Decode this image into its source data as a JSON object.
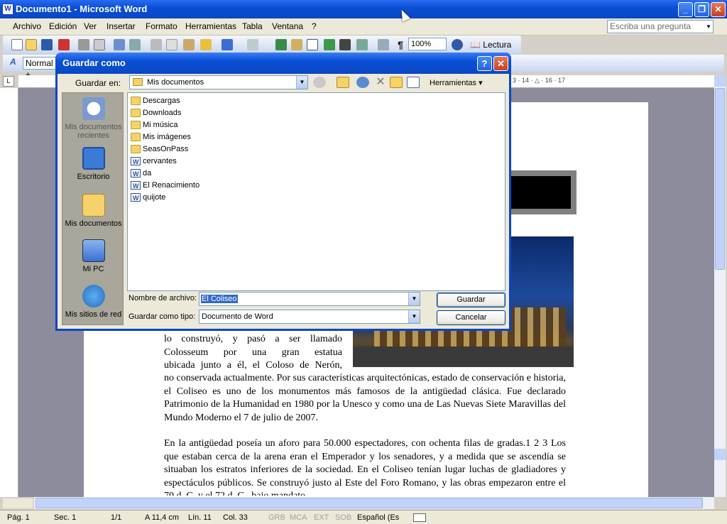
{
  "window": {
    "title": "Documento1 - Microsoft Word"
  },
  "menu": [
    "Archivo",
    "Edición",
    "Ver",
    "Insertar",
    "Formato",
    "Herramientas",
    "Tabla",
    "Ventana",
    "?"
  ],
  "ask": {
    "placeholder": "Escriba una pregunta"
  },
  "toolbar": {
    "zoom": "100%",
    "lectura": "Lectura",
    "style": "Normal +"
  },
  "ruler": {
    "marks": "3 · 14 · △ · 16 · 17"
  },
  "dialog": {
    "title": "Guardar como",
    "save_in_label": "Guardar en:",
    "save_in_value": "Mis documentos",
    "tools_label": "Herramientas",
    "places": [
      "Mis documentos recientes",
      "Escritorio",
      "Mis documentos",
      "Mi PC",
      "Mis sitios de red"
    ],
    "files": [
      {
        "name": "Descargas",
        "type": "folder"
      },
      {
        "name": "Downloads",
        "type": "folder"
      },
      {
        "name": "Mi música",
        "type": "folder"
      },
      {
        "name": "Mis imágenes",
        "type": "folder"
      },
      {
        "name": "SeasOnPass",
        "type": "folder"
      },
      {
        "name": "cervantes",
        "type": "doc"
      },
      {
        "name": "da",
        "type": "doc"
      },
      {
        "name": "El Renacimiento",
        "type": "doc"
      },
      {
        "name": "quijote",
        "type": "doc"
      }
    ],
    "filename_label": "Nombre de archivo:",
    "filename_value": "El Coliseo",
    "filetype_label": "Guardar como tipo:",
    "filetype_value": "Documento de Word",
    "save_button": "Guardar",
    "cancel_button": "Cancelar"
  },
  "document": {
    "para1_lines": [
      "lo construyó, y pasó a ser llamado",
      "Colosseum por una gran estatua",
      "ubicada junto a él, el Coloso de Nerón,"
    ],
    "para1_rest": "no conservada actualmente. Por sus características arquitectónicas, estado de conservación e historia, el Coliseo es uno de los monumentos más famosos de la antigüedad clásica. Fue declarado Patrimonio de la Humanidad en 1980 por la Unesco y como una de Las Nuevas Siete Maravillas del Mundo Moderno el 7 de julio de 2007.",
    "para2": "En la antigüedad poseía un aforo para 50.000 espectadores, con ochenta filas de gradas.1 2 3 Los que estaban cerca de la arena eran el Emperador y los senadores, y a medida que se ascendía se situaban los estratos inferiores de la sociedad. En el Coliseo tenían lugar luchas de gladiadores y espectáculos públicos. Se construyó justo al Este del Foro Romano, y las obras empezaron entre el 70 d. C. y el 72 d. C., bajo mandato"
  },
  "status": {
    "page": "Pág. 1",
    "sec": "Sec. 1",
    "count": "1/1",
    "at": "A 11,4 cm",
    "line": "Lín. 11",
    "col": "Col. 33",
    "grb": "GRB",
    "mca": "MCA",
    "ext": "EXT",
    "sob": "SOB",
    "lang": "Español (Es"
  }
}
